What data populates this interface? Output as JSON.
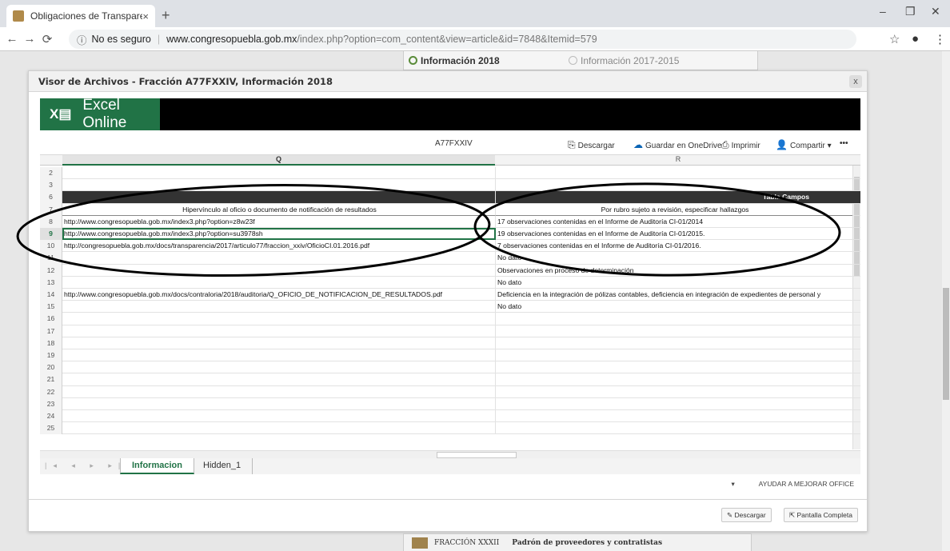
{
  "browser": {
    "tab_title": "Obligaciones de Transparencia",
    "tab_close": "×",
    "new_tab": "+",
    "security": "No es seguro",
    "url_domain": "www.congresopuebla.gob.mx",
    "url_path": "/index.php?option=com_content&view=article&id=7848&Itemid=579",
    "win_min": "–",
    "win_max": "❐",
    "win_close": "✕"
  },
  "page": {
    "tab_2018": "Información 2018",
    "tab_old": "Información 2017-2015"
  },
  "dialog": {
    "title": "Visor de Archivos - Fracción A77FXXIV, Información 2018",
    "close": "x"
  },
  "excel": {
    "brand": "Excel Online",
    "file_name": "A77FXXIV",
    "download": "Descargar",
    "onedrive": "Guardar en OneDrive",
    "print": "Imprimir",
    "share": "Compartir",
    "more": "•••",
    "col_q": "Q",
    "col_r": "R",
    "rows": [
      {
        "n": "2",
        "q": "",
        "r": ""
      },
      {
        "n": "3",
        "q": "",
        "r": ""
      },
      {
        "n": "6",
        "q": "",
        "r": "Tabla Campos"
      },
      {
        "n": "7",
        "q": "Hipervínculo al oficio o documento de notificación de resultados",
        "r": "Por rubro sujeto a revisión, especificar hallazgos"
      },
      {
        "n": "8",
        "q": "http://www.congresopuebla.gob.mx/index3.php?option=z8w23f",
        "r": "17 observaciones contenidas en el Informe de Auditoría CI-01/2014"
      },
      {
        "n": "9",
        "q": "http://www.congresopuebla.gob.mx/index3.php?option=su3978sh",
        "r": "19 observaciones contenidas en el Informe de Auditoría CI-01/2015."
      },
      {
        "n": "10",
        "q": "http://congresopuebla.gob.mx/docs/transparencia/2017/articulo77/fraccion_xxiv/OficioCI.01.2016.pdf",
        "r": "7 observaciones contenidas en el Informe de Auditoría CI-01/2016."
      },
      {
        "n": "11",
        "q": "",
        "r": "No dato"
      },
      {
        "n": "12",
        "q": "",
        "r": "Observaciones en proceso de determinación"
      },
      {
        "n": "13",
        "q": "",
        "r": "No dato"
      },
      {
        "n": "14",
        "q": "http://www.congresopuebla.gob.mx/docs/contraloria/2018/auditoria/Q_OFICIO_DE_NOTIFICACION_DE_RESULTADOS.pdf",
        "r": "Deficiencia en la integración de pólizas contables, deficiencia en integración de expedientes de personal y"
      },
      {
        "n": "15",
        "q": "",
        "r": "No dato"
      },
      {
        "n": "16",
        "q": "",
        "r": ""
      },
      {
        "n": "17",
        "q": "",
        "r": ""
      },
      {
        "n": "18",
        "q": "",
        "r": ""
      },
      {
        "n": "19",
        "q": "",
        "r": ""
      },
      {
        "n": "20",
        "q": "",
        "r": ""
      },
      {
        "n": "21",
        "q": "",
        "r": ""
      },
      {
        "n": "22",
        "q": "",
        "r": ""
      },
      {
        "n": "23",
        "q": "",
        "r": ""
      },
      {
        "n": "24",
        "q": "",
        "r": ""
      },
      {
        "n": "25",
        "q": "",
        "r": ""
      }
    ],
    "sheet_active": "Informacion",
    "sheet_other": "Hidden_1",
    "help": "AYUDAR A MEJORAR OFFICE"
  },
  "footer": {
    "download": "Descargar",
    "fullscreen": "Pantalla Completa"
  },
  "bottom": {
    "label": "FRACCIÓN XXXII",
    "title": "Padrón de proveedores y contratistas"
  }
}
